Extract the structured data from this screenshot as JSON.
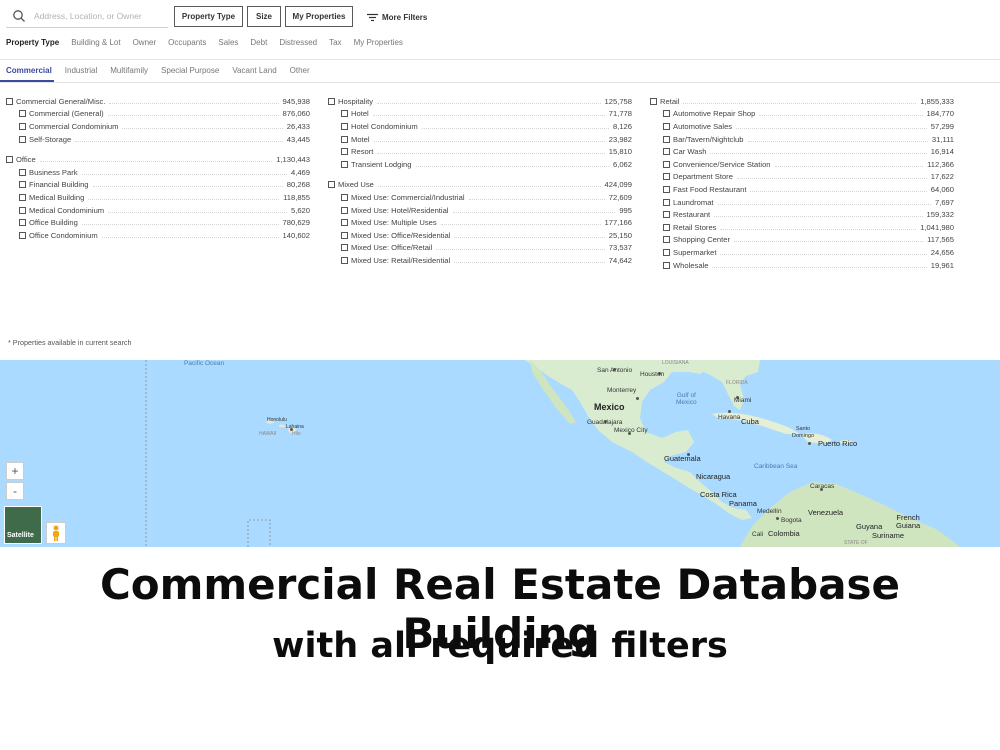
{
  "search": {
    "placeholder": "Address, Location, or Owner"
  },
  "toolbar": {
    "property_type": "Property Type",
    "size": "Size",
    "my_properties": "My Properties",
    "more_filters": "More Filters"
  },
  "category_tabs": [
    "Property Type",
    "Building & Lot",
    "Owner",
    "Occupants",
    "Sales",
    "Debt",
    "Distressed",
    "Tax",
    "My Properties"
  ],
  "sub_tabs": [
    "Commercial",
    "Industrial",
    "Multifamily",
    "Special Purpose",
    "Vacant Land",
    "Other"
  ],
  "columns": [
    {
      "groups": [
        {
          "label": "Commercial General/Misc.",
          "count": "945,938",
          "items": [
            {
              "label": "Commercial (General)",
              "count": "876,060"
            },
            {
              "label": "Commercial Condominium",
              "count": "26,433"
            },
            {
              "label": "Self-Storage",
              "count": "43,445"
            }
          ]
        },
        {
          "label": "Office",
          "count": "1,130,443",
          "items": [
            {
              "label": "Business Park",
              "count": "4,469"
            },
            {
              "label": "Financial Building",
              "count": "80,268"
            },
            {
              "label": "Medical Building",
              "count": "118,855"
            },
            {
              "label": "Medical Condominium",
              "count": "5,620"
            },
            {
              "label": "Office Building",
              "count": "780,629"
            },
            {
              "label": "Office Condominium",
              "count": "140,602"
            }
          ]
        }
      ]
    },
    {
      "groups": [
        {
          "label": "Hospitality",
          "count": "125,758",
          "items": [
            {
              "label": "Hotel",
              "count": "71,778"
            },
            {
              "label": "Hotel Condominium",
              "count": "8,126"
            },
            {
              "label": "Motel",
              "count": "23,982"
            },
            {
              "label": "Resort",
              "count": "15,810"
            },
            {
              "label": "Transient Lodging",
              "count": "6,062"
            }
          ]
        },
        {
          "label": "Mixed Use",
          "count": "424,099",
          "items": [
            {
              "label": "Mixed Use: Commercial/Industrial",
              "count": "72,609"
            },
            {
              "label": "Mixed Use: Hotel/Residential",
              "count": "995"
            },
            {
              "label": "Mixed Use: Multiple Uses",
              "count": "177,166"
            },
            {
              "label": "Mixed Use: Office/Residential",
              "count": "25,150"
            },
            {
              "label": "Mixed Use: Office/Retail",
              "count": "73,537"
            },
            {
              "label": "Mixed Use: Retail/Residential",
              "count": "74,642"
            }
          ]
        }
      ]
    },
    {
      "groups": [
        {
          "label": "Retail",
          "count": "1,855,333",
          "items": [
            {
              "label": "Automotive Repair Shop",
              "count": "184,770"
            },
            {
              "label": "Automotive Sales",
              "count": "57,299"
            },
            {
              "label": "Bar/Tavern/Nightclub",
              "count": "31,111"
            },
            {
              "label": "Car Wash",
              "count": "16,914"
            },
            {
              "label": "Convenience/Service Station",
              "count": "112,366"
            },
            {
              "label": "Department Store",
              "count": "17,622"
            },
            {
              "label": "Fast Food Restaurant",
              "count": "64,060"
            },
            {
              "label": "Laundromat",
              "count": "7,697"
            },
            {
              "label": "Restaurant",
              "count": "159,332"
            },
            {
              "label": "Retail Stores",
              "count": "1,041,980"
            },
            {
              "label": "Shopping Center",
              "count": "117,565"
            },
            {
              "label": "Supermarket",
              "count": "24,656"
            },
            {
              "label": "Wholesale",
              "count": "19,961"
            }
          ]
        }
      ]
    }
  ],
  "footnote": "* Properties available in current search",
  "map": {
    "zoom_in": "+",
    "zoom_out": "-",
    "satellite": "Satellite",
    "labels": {
      "pacific": "Pacific\nOcean",
      "honolulu": "Honolulu",
      "lahaina": "Lahaina",
      "hawaii": "HAWAII",
      "hilo": "Hilo",
      "san_antonio": "San Antonio",
      "houston": "Houston",
      "louisiana": "LOUISIANA",
      "florida": "FLORIDA",
      "gulf": "Gulf of\nMexico",
      "miami": "Miami",
      "monterrey": "Monterrey",
      "mexico": "Mexico",
      "guadalajara": "Guadalajara",
      "mexico_city": "Mexico City",
      "havana": "Havana",
      "cuba": "Cuba",
      "santo_domingo": "Santo\nDomingo",
      "puerto_rico": "Puerto Rico",
      "guatemala": "Guatemala",
      "caribbean": "Caribbean Sea",
      "nicaragua": "Nicaragua",
      "costa_rica": "Costa Rica",
      "panama": "Panama",
      "caracas": "Caracas",
      "medellin": "Medellín",
      "venezuela": "Venezuela",
      "bogota": "Bogota",
      "colombia": "Colombia",
      "cali": "Cali",
      "guyana": "Guyana",
      "suriname": "Suriname",
      "french_guiana": "French\nGuiana",
      "state_of": "STATE OF"
    }
  },
  "headline": "Commercial Real Estate Database Building",
  "subheadline": "with all required filters"
}
